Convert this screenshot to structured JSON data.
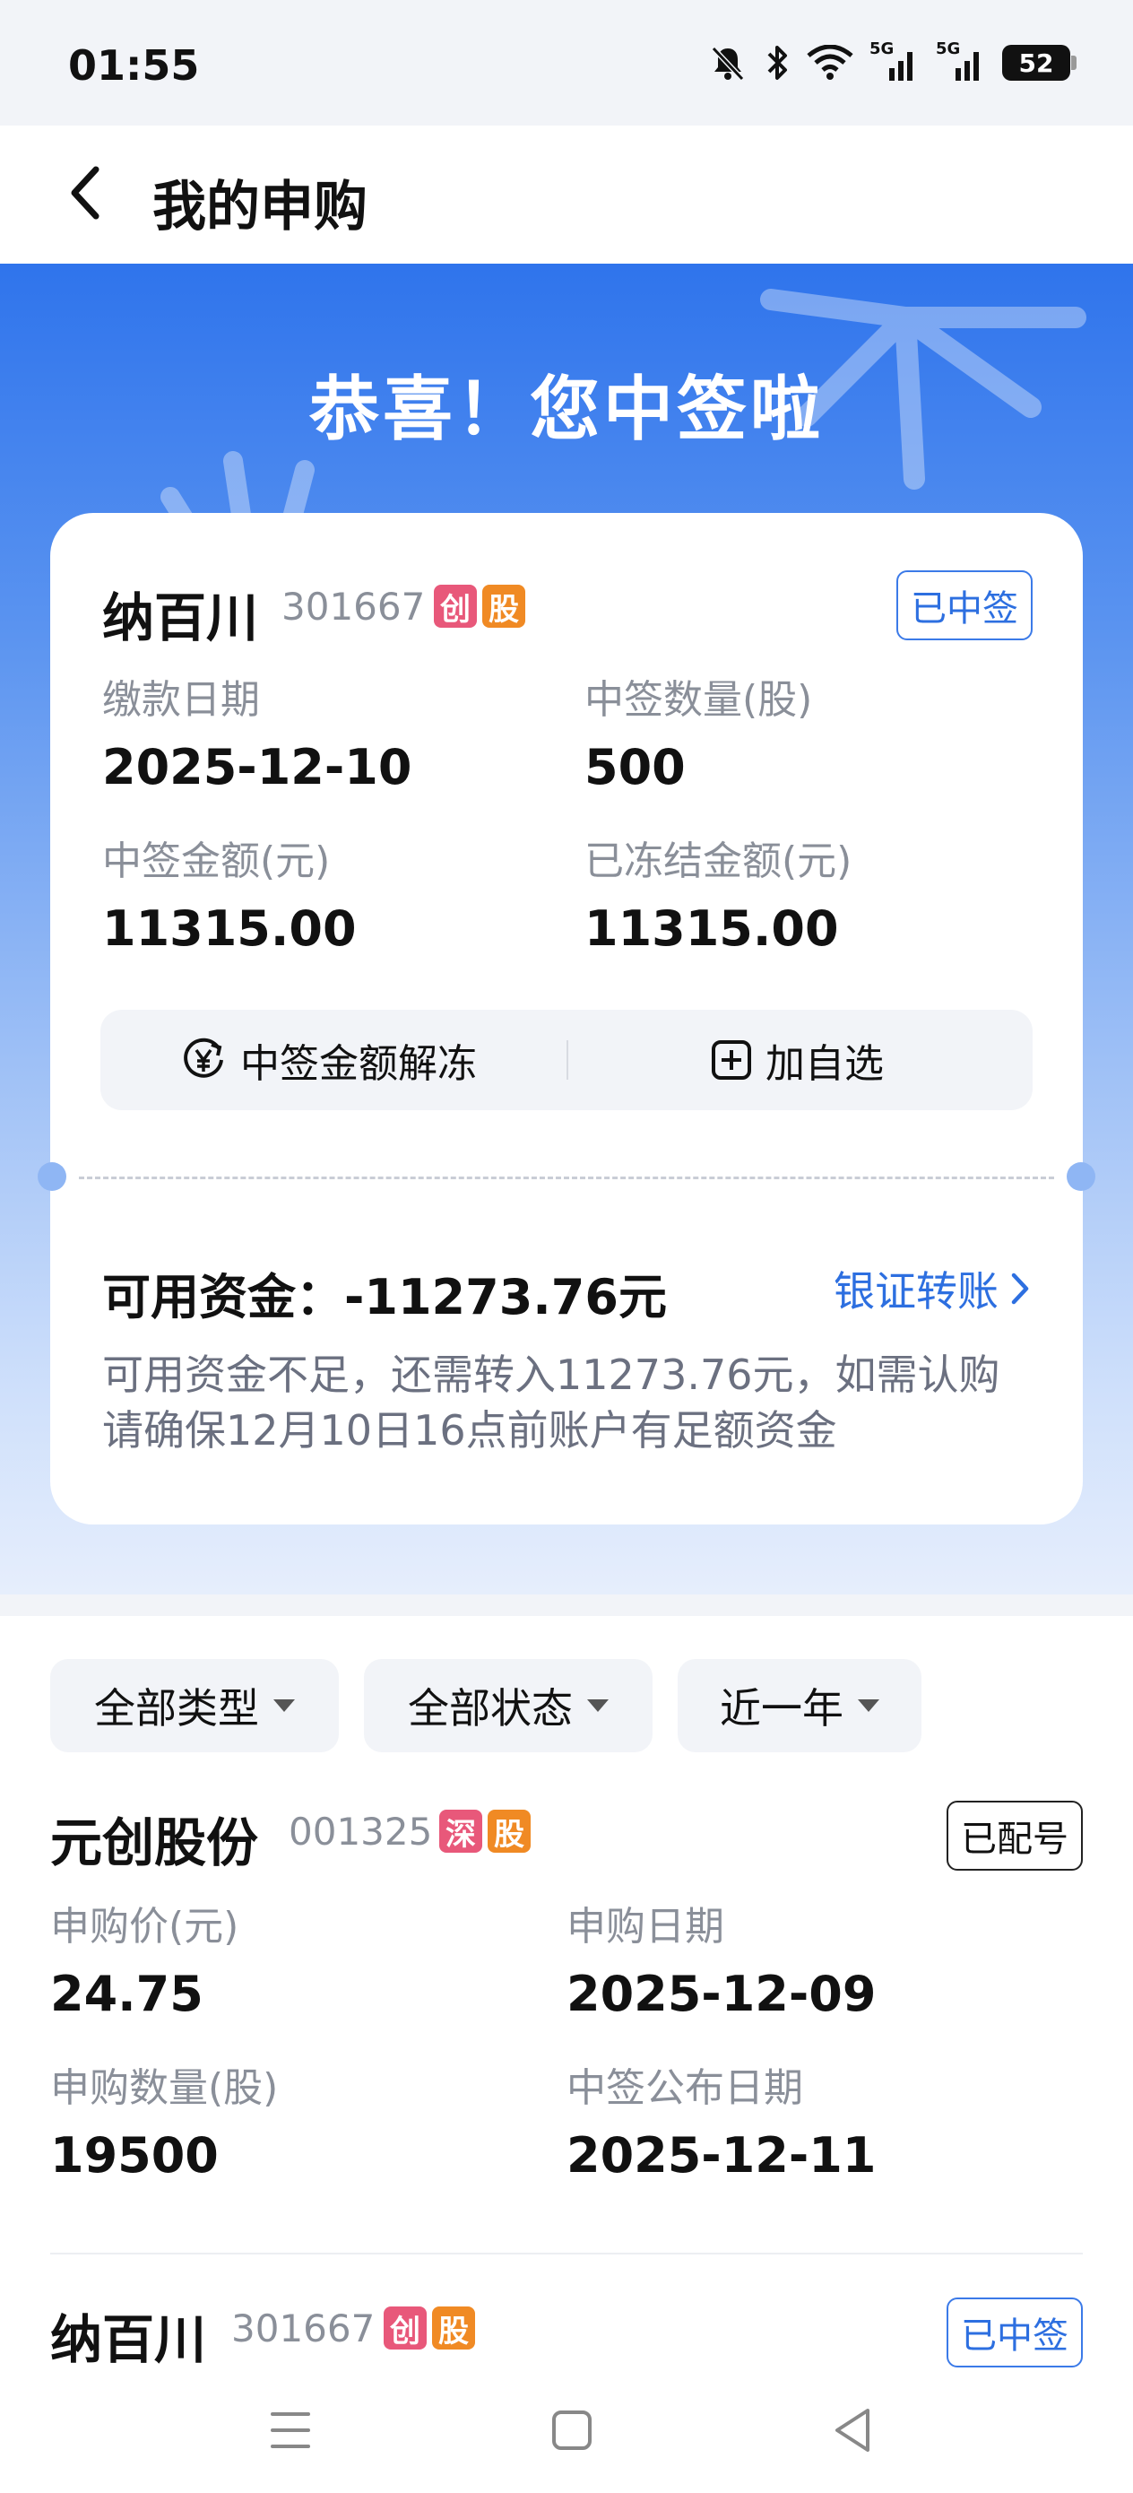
{
  "status_bar": {
    "time": "01:55",
    "battery": "52",
    "network_1": "5G",
    "network_2": "5G"
  },
  "nav": {
    "title": "我的申购"
  },
  "banner": {
    "title": "恭喜！您中签啦"
  },
  "win_card": {
    "name": "纳百川",
    "code": "301667",
    "tags": [
      "创",
      "股"
    ],
    "status": "已中签",
    "fields": [
      {
        "label": "缴款日期",
        "value": "2025-12-10"
      },
      {
        "label": "中签数量(股)",
        "value": "500"
      },
      {
        "label": "中签金额(元)",
        "value": "11315.00"
      },
      {
        "label": "已冻结金额(元)",
        "value": "11315.00"
      }
    ],
    "actions": {
      "unfreeze": "中签金额解冻",
      "add_watchlist": "加自选"
    },
    "available_funds": "可用资金：-11273.76元",
    "transfer": "银证转账",
    "note": "可用资金不足，还需转入11273.76元，如需认购请确保12月10日16点前账户有足额资金"
  },
  "filters": [
    {
      "label": "全部类型"
    },
    {
      "label": "全部状态"
    },
    {
      "label": "近一年"
    }
  ],
  "subscriptions": [
    {
      "name": "元创股份",
      "code": "001325",
      "tags": [
        "深",
        "股"
      ],
      "status": "已配号",
      "fields": [
        {
          "label": "申购价(元)",
          "value": "24.75"
        },
        {
          "label": "申购日期",
          "value": "2025-12-09"
        },
        {
          "label": "申购数量(股)",
          "value": "19500"
        },
        {
          "label": "中签公布日期",
          "value": "2025-12-11"
        }
      ]
    },
    {
      "name": "纳百川",
      "code": "301667",
      "tags": [
        "创",
        "股"
      ],
      "status": "已中签"
    }
  ],
  "colors": {
    "accent": "#2d6fe0",
    "banner_top": "#2f74ec",
    "tag_red": "#e8587a",
    "tag_orange": "#f08a24"
  },
  "icons": [
    "mute-icon",
    "bluetooth-icon",
    "wifi-icon",
    "signal-icon",
    "battery-icon",
    "back-arrow-icon",
    "yen-cycle-icon",
    "add-square-icon",
    "chevron-right-icon",
    "menu-icon",
    "home-square-icon",
    "back-triangle-icon"
  ]
}
